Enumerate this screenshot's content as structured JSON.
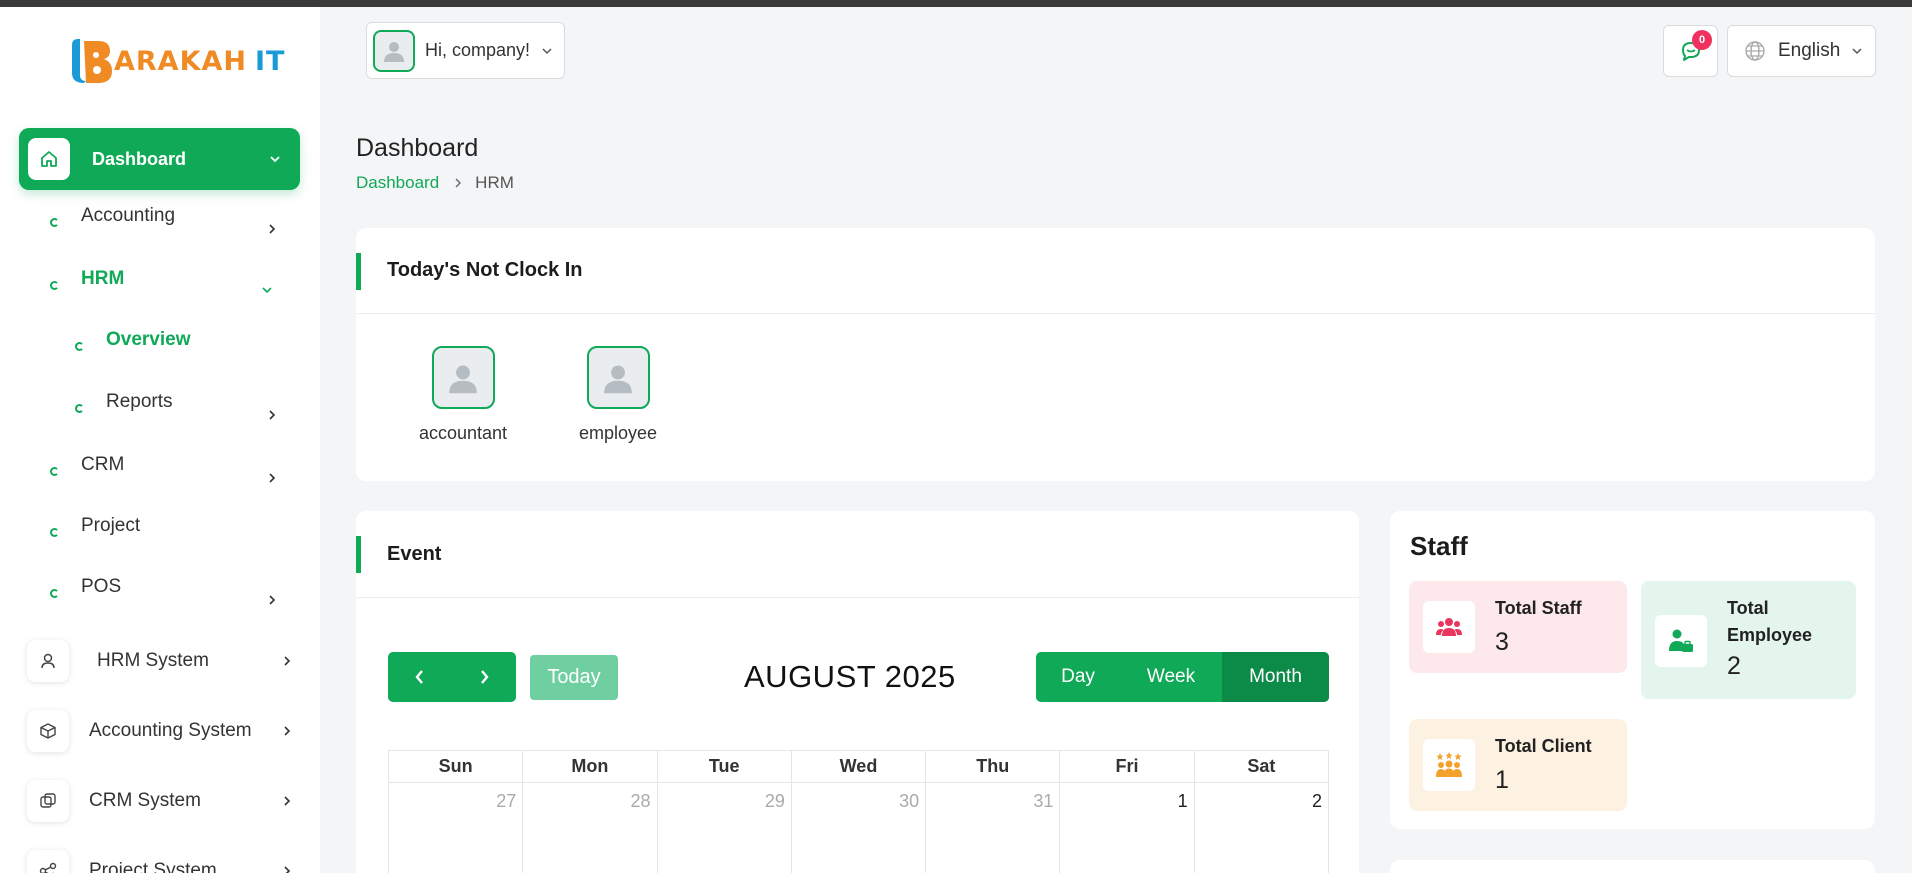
{
  "brand": {
    "name": "ARAKAH",
    "suffix": "IT"
  },
  "header": {
    "greeting": "Hi, company!",
    "notification_count": "0",
    "language": "English"
  },
  "sidebar": {
    "dashboard": "Dashboard",
    "sub": {
      "accounting": "Accounting",
      "hrm": "HRM",
      "overview": "Overview",
      "reports": "Reports",
      "crm": "CRM",
      "project": "Project",
      "pos": "POS"
    },
    "systems": {
      "hrm": "HRM System",
      "accounting": "Accounting System",
      "crm": "CRM System",
      "project": "Project System"
    }
  },
  "page": {
    "title": "Dashboard",
    "breadcrumb": [
      "Dashboard",
      "HRM"
    ]
  },
  "not_clock_in": {
    "title": "Today's Not Clock In",
    "employees": [
      "accountant",
      "employee"
    ]
  },
  "event": {
    "title": "Event",
    "today_label": "Today",
    "month_title": "AUGUST 2025",
    "views": [
      "Day",
      "Week",
      "Month"
    ],
    "active_view": "Month",
    "weekdays": [
      "Sun",
      "Mon",
      "Tue",
      "Wed",
      "Thu",
      "Fri",
      "Sat"
    ],
    "first_week": [
      "27",
      "28",
      "29",
      "30",
      "31",
      "1",
      "2"
    ]
  },
  "staff": {
    "title": "Staff",
    "total_staff_label": "Total Staff",
    "total_staff": "3",
    "total_employee_label": "Total Employee",
    "total_employee": "2",
    "total_client_label": "Total Client",
    "total_client": "1"
  },
  "colors": {
    "accent": "#10a957",
    "badge": "#f0305f",
    "brand_orange": "#f08a24",
    "brand_blue": "#1a9ad6"
  }
}
